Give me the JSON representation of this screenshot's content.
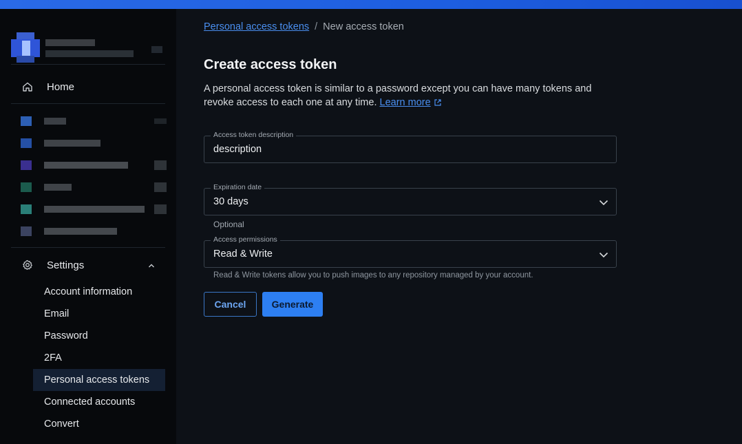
{
  "sidebar": {
    "home_label": "Home",
    "settings_label": "Settings",
    "settings_items": [
      {
        "label": "Account information"
      },
      {
        "label": "Email"
      },
      {
        "label": "Password"
      },
      {
        "label": "2FA"
      },
      {
        "label": "Personal access tokens",
        "active": true
      },
      {
        "label": "Connected accounts"
      },
      {
        "label": "Convert"
      }
    ]
  },
  "breadcrumb": {
    "parent": "Personal access tokens",
    "separator": "/",
    "current": "New access token"
  },
  "page": {
    "title": "Create access token",
    "description": "A personal access token is similar to a password except you can have many tokens and revoke access to each one at any time.",
    "learn_more": "Learn more"
  },
  "form": {
    "description_field": {
      "legend": "Access token description",
      "value": "description"
    },
    "expiration_field": {
      "legend": "Expiration date",
      "value": "30 days",
      "helper": "Optional"
    },
    "permissions_field": {
      "legend": "Access permissions",
      "value": "Read & Write",
      "helper": "Read & Write tokens allow you to push images to any repository managed by your account."
    },
    "cancel_label": "Cancel",
    "generate_label": "Generate"
  },
  "colors": {
    "accent": "#2d7ff2",
    "link": "#4a8ff0",
    "sidebar_bg": "#07090c",
    "main_bg": "#0d1117",
    "topbar": "#1d5ee0"
  }
}
